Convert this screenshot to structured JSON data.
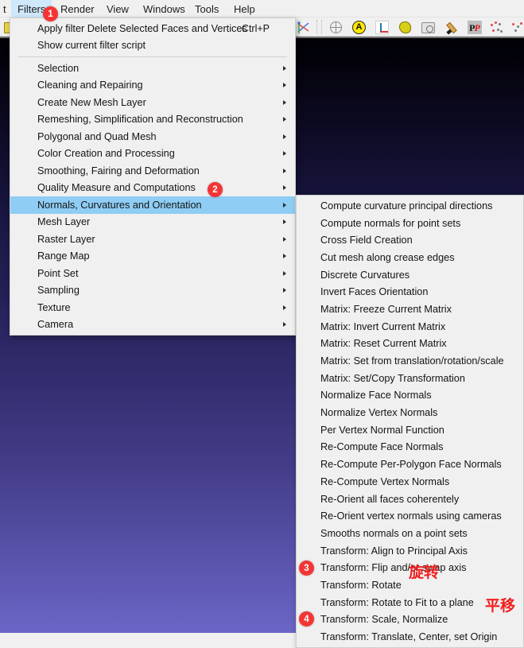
{
  "app": {
    "viewport_name": "3d-viewport"
  },
  "menubar": {
    "items": [
      {
        "label": "Filters",
        "active": true
      },
      {
        "label": "Render",
        "active": false
      },
      {
        "label": "View",
        "active": false
      },
      {
        "label": "Windows",
        "active": false
      },
      {
        "label": "Tools",
        "active": false
      },
      {
        "label": "Help",
        "active": false
      }
    ]
  },
  "toolbar": {
    "icons": [
      {
        "name": "open-folder-icon"
      },
      {
        "name": "axes-cross-icon"
      },
      {
        "name": "globe-icon"
      },
      {
        "name": "align-a-icon"
      },
      {
        "name": "axes-origin-icon"
      },
      {
        "name": "pear-measure-icon"
      },
      {
        "name": "camera-alignment-icon"
      },
      {
        "name": "paint-brush-icon"
      },
      {
        "name": "pp-picture-icon"
      },
      {
        "name": "point-cloud-icon"
      },
      {
        "name": "point-cloud-2-icon"
      }
    ]
  },
  "filters_menu": {
    "title": "Filters",
    "items": [
      {
        "label": "Apply filter Delete Selected Faces and Vertices",
        "shortcut": "Ctrl+P",
        "submenu": false,
        "selected": false
      },
      {
        "label": "Show current filter script",
        "shortcut": "",
        "submenu": false,
        "selected": false
      },
      {
        "separator": true
      },
      {
        "label": "Selection",
        "shortcut": "",
        "submenu": true,
        "selected": false
      },
      {
        "label": "Cleaning and Repairing",
        "shortcut": "",
        "submenu": true,
        "selected": false
      },
      {
        "label": "Create New Mesh Layer",
        "shortcut": "",
        "submenu": true,
        "selected": false
      },
      {
        "label": "Remeshing, Simplification and Reconstruction",
        "shortcut": "",
        "submenu": true,
        "selected": false
      },
      {
        "label": "Polygonal and Quad Mesh",
        "shortcut": "",
        "submenu": true,
        "selected": false
      },
      {
        "label": "Color Creation and Processing",
        "shortcut": "",
        "submenu": true,
        "selected": false
      },
      {
        "label": "Smoothing, Fairing and Deformation",
        "shortcut": "",
        "submenu": true,
        "selected": false
      },
      {
        "label": "Quality Measure and Computations",
        "shortcut": "",
        "submenu": true,
        "selected": false
      },
      {
        "label": "Normals, Curvatures and Orientation",
        "shortcut": "",
        "submenu": true,
        "selected": true
      },
      {
        "label": "Mesh Layer",
        "shortcut": "",
        "submenu": true,
        "selected": false
      },
      {
        "label": "Raster Layer",
        "shortcut": "",
        "submenu": true,
        "selected": false
      },
      {
        "label": "Range Map",
        "shortcut": "",
        "submenu": true,
        "selected": false
      },
      {
        "label": "Point Set",
        "shortcut": "",
        "submenu": true,
        "selected": false
      },
      {
        "label": "Sampling",
        "shortcut": "",
        "submenu": true,
        "selected": false
      },
      {
        "label": "Texture",
        "shortcut": "",
        "submenu": true,
        "selected": false
      },
      {
        "label": "Camera",
        "shortcut": "",
        "submenu": true,
        "selected": false
      }
    ]
  },
  "normals_submenu": {
    "title": "Normals, Curvatures and Orientation",
    "items": [
      {
        "label": "Compute curvature principal directions"
      },
      {
        "label": "Compute normals for point sets"
      },
      {
        "label": "Cross Field Creation"
      },
      {
        "label": "Cut mesh along crease edges"
      },
      {
        "label": "Discrete Curvatures"
      },
      {
        "label": "Invert Faces Orientation"
      },
      {
        "label": "Matrix: Freeze Current Matrix"
      },
      {
        "label": "Matrix: Invert Current Matrix"
      },
      {
        "label": "Matrix: Reset Current Matrix"
      },
      {
        "label": "Matrix: Set from translation/rotation/scale"
      },
      {
        "label": "Matrix: Set/Copy Transformation"
      },
      {
        "label": "Normalize Face Normals"
      },
      {
        "label": "Normalize Vertex Normals"
      },
      {
        "label": "Per Vertex Normal Function"
      },
      {
        "label": "Re-Compute Face Normals"
      },
      {
        "label": "Re-Compute Per-Polygon Face Normals"
      },
      {
        "label": "Re-Compute Vertex Normals"
      },
      {
        "label": "Re-Orient all faces coherentely"
      },
      {
        "label": "Re-Orient vertex normals using cameras"
      },
      {
        "label": "Smooths normals on a point sets"
      },
      {
        "label": "Transform: Align to Principal Axis"
      },
      {
        "label": "Transform: Flip and/or swap axis"
      },
      {
        "label": "Transform: Rotate"
      },
      {
        "label": "Transform: Rotate to Fit to a plane"
      },
      {
        "label": "Transform: Scale, Normalize"
      },
      {
        "label": "Transform: Translate, Center, set Origin"
      }
    ]
  },
  "annotations": {
    "badges": [
      {
        "number": "1",
        "target": "menubar-filters"
      },
      {
        "number": "2",
        "target": "filters-normals-curvatures-orientation"
      },
      {
        "number": "3",
        "target": "submenu-transform-rotate"
      },
      {
        "number": "4",
        "target": "submenu-transform-translate"
      }
    ],
    "notes": [
      {
        "text": "旋转",
        "target": "submenu-transform-rotate"
      },
      {
        "text": "平移",
        "target": "submenu-transform-translate"
      }
    ],
    "color": "#f43535"
  }
}
